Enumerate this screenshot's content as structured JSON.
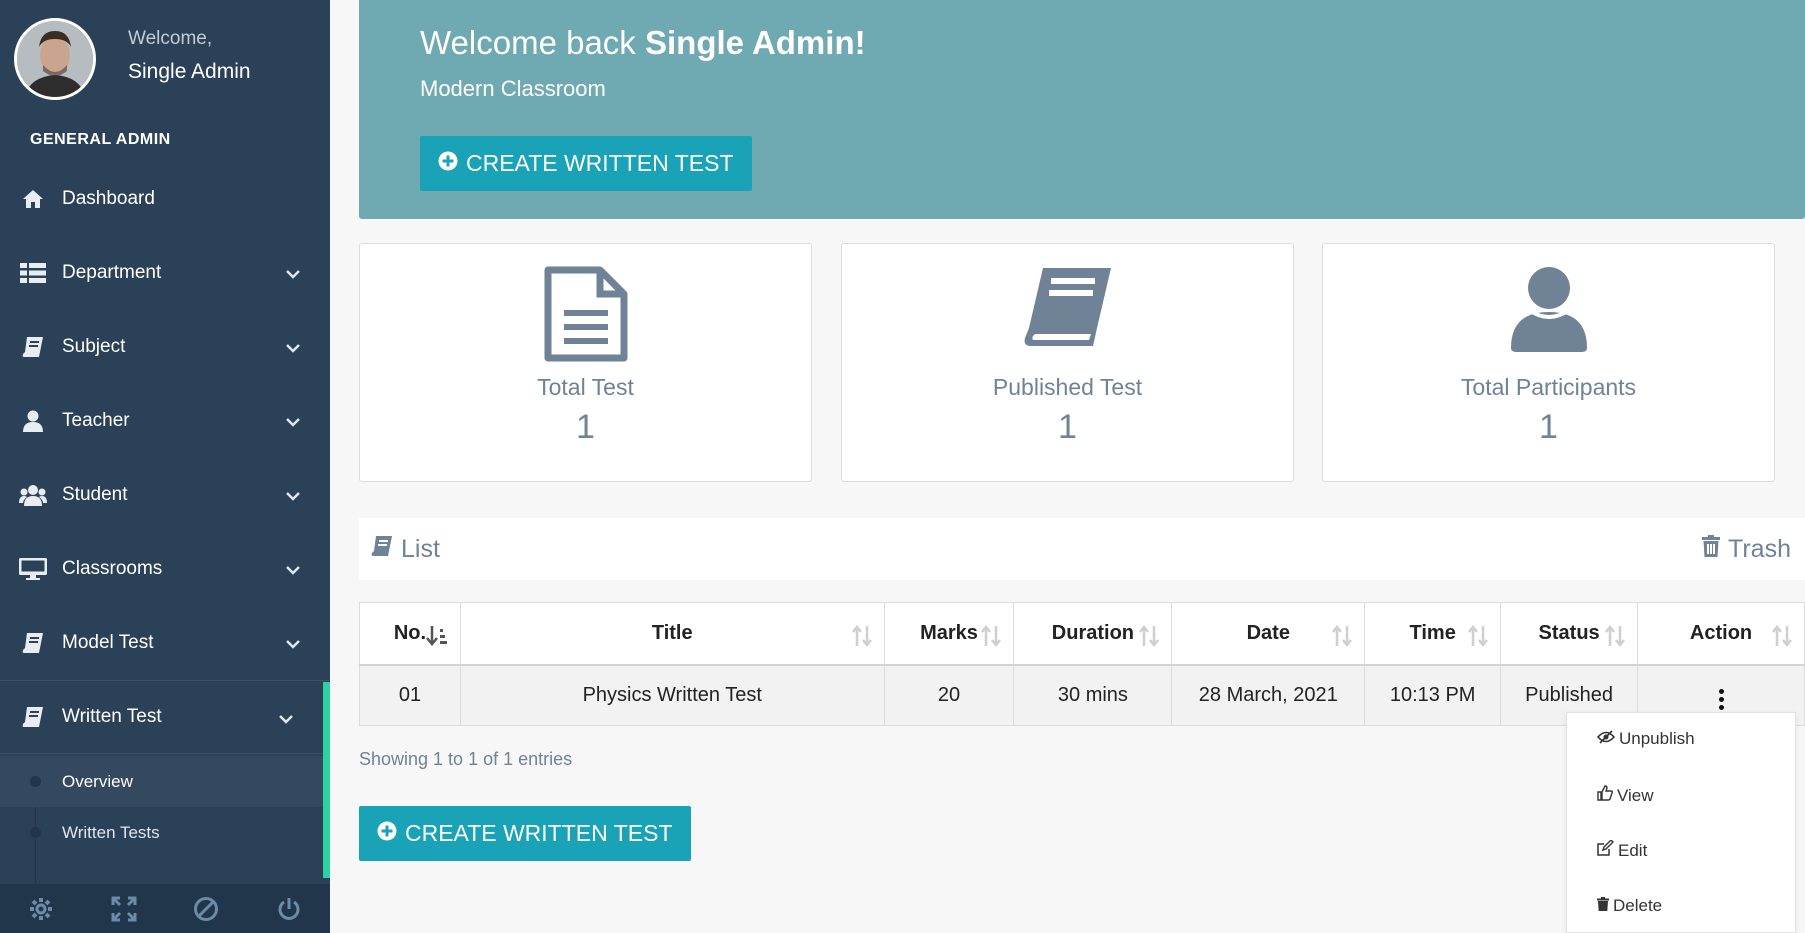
{
  "sidebar": {
    "welcome": "Welcome,",
    "user_name": "Single Admin",
    "role": "GENERAL ADMIN",
    "items": [
      {
        "label": "Dashboard",
        "icon": "home-icon"
      },
      {
        "label": "Department",
        "icon": "list-icon"
      },
      {
        "label": "Subject",
        "icon": "book-icon"
      },
      {
        "label": "Teacher",
        "icon": "user-icon"
      },
      {
        "label": "Student",
        "icon": "users-icon"
      },
      {
        "label": "Classrooms",
        "icon": "desktop-icon"
      },
      {
        "label": "Model Test",
        "icon": "book-icon"
      },
      {
        "label": "Written Test",
        "icon": "book-icon"
      }
    ],
    "sub_items": [
      {
        "label": "Overview"
      },
      {
        "label": "Written Tests"
      }
    ],
    "footer_icons": [
      "gear-icon",
      "fullscreen-icon",
      "ban-icon",
      "power-icon"
    ]
  },
  "hero": {
    "welcome_prefix": "Welcome back ",
    "welcome_name": "Single Admin!",
    "subtitle": "Modern Classroom",
    "button_label": "CREATE WRITTEN TEST"
  },
  "stats": [
    {
      "label": "Total Test",
      "value": "1",
      "icon": "document-icon"
    },
    {
      "label": "Published Test",
      "value": "1",
      "icon": "book-icon"
    },
    {
      "label": "Total Participants",
      "value": "1",
      "icon": "user-icon"
    }
  ],
  "list": {
    "title": "List",
    "trash_label": "Trash"
  },
  "table": {
    "headers": [
      "No.",
      "Title",
      "Marks",
      "Duration",
      "Date",
      "Time",
      "Status",
      "Action"
    ],
    "rows": [
      {
        "no": "01",
        "title": "Physics Written Test",
        "marks": "20",
        "duration": "30 mins",
        "date": "28 March, 2021",
        "time": "10:13 PM",
        "status": "Published"
      }
    ]
  },
  "entries_info": "Showing 1 to 1 of 1 entries",
  "bottom_button_label": "CREATE WRITTEN TEST",
  "dropdown": {
    "items": [
      {
        "label": "Unpublish",
        "icon": "eye-slash-icon"
      },
      {
        "label": "View",
        "icon": "thumbs-up-icon"
      },
      {
        "label": "Edit",
        "icon": "edit-icon"
      },
      {
        "label": "Delete",
        "icon": "trash-icon"
      }
    ]
  },
  "colors": {
    "sidebar_bg": "#2b4157",
    "hero_bg": "#6fa9b1",
    "button_bg": "#1aa3b6",
    "active_accent": "#2bd3a3",
    "stat_text": "#6f8296"
  }
}
